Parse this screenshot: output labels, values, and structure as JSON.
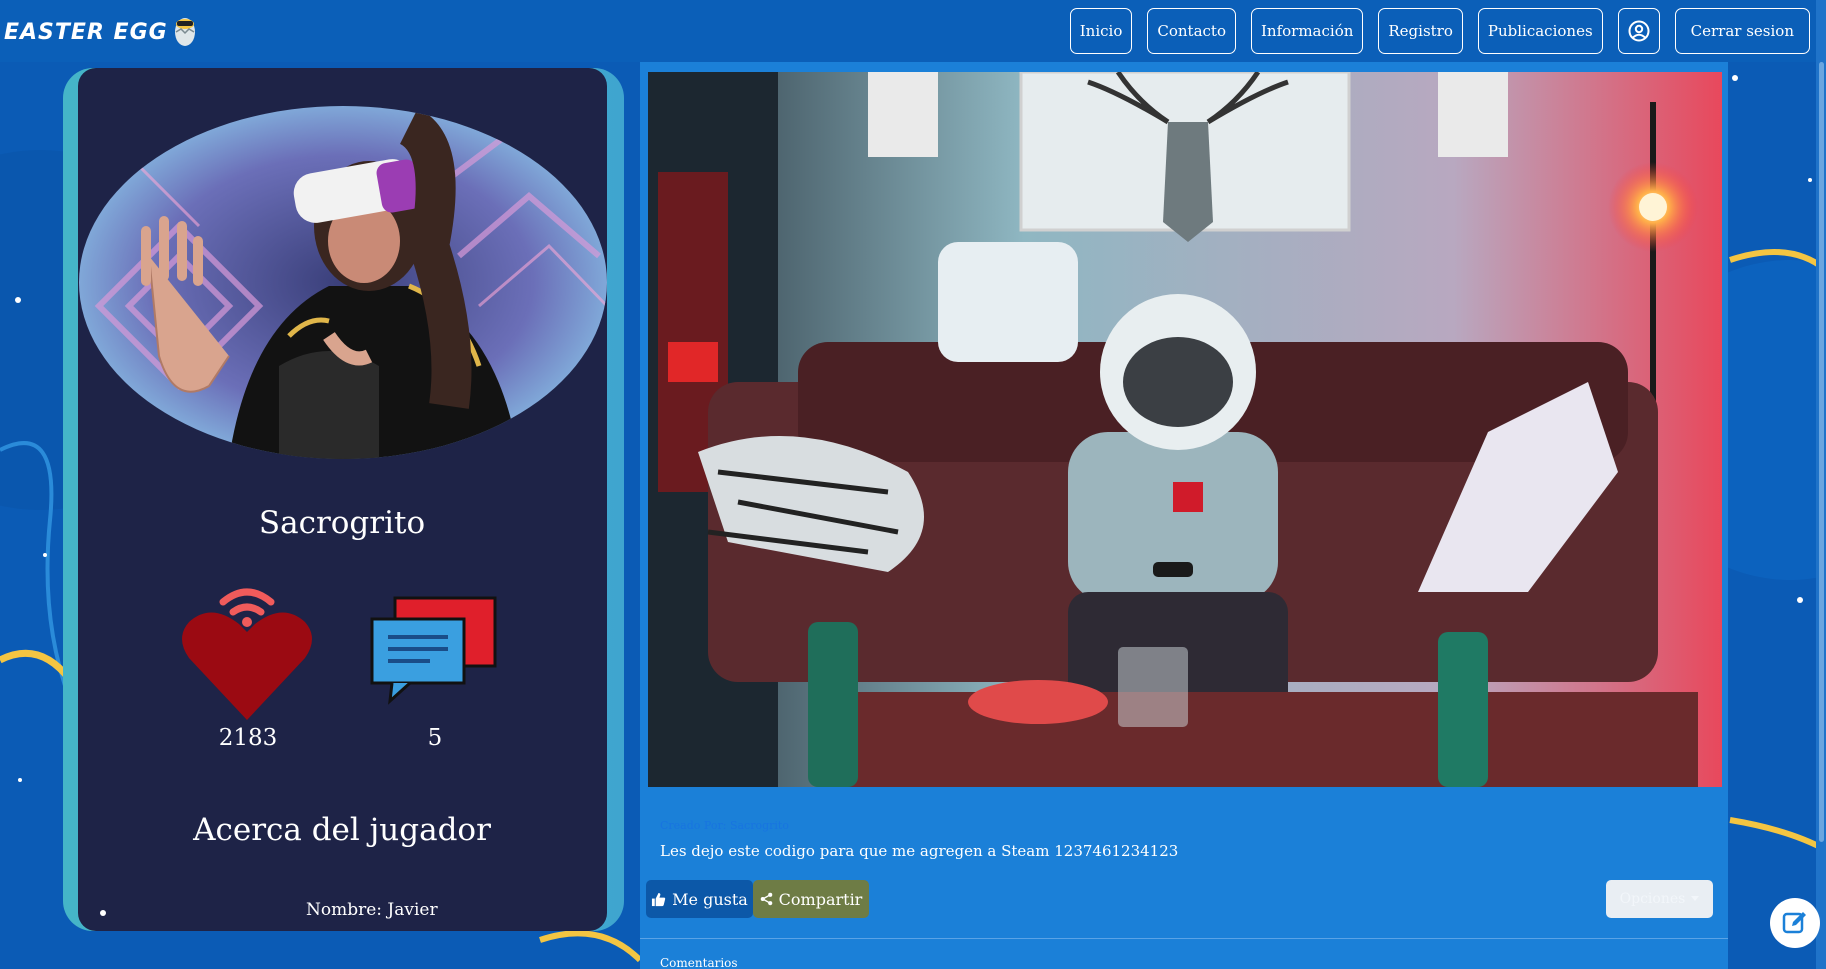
{
  "header": {
    "logo_text": "EASTER EGG",
    "nav": {
      "inicio": "Inicio",
      "contacto": "Contacto",
      "informacion": "Información",
      "registro": "Registro",
      "publicaciones": "Publicaciones",
      "cerrar_sesion": "Cerrar sesion"
    },
    "profile_icon": "user-circle-icon"
  },
  "profile": {
    "name": "Sacrogrito",
    "likes_count": "2183",
    "comments_count": "5",
    "about_title": "Acerca del jugador",
    "about_items": [
      "Nombre: Javier"
    ],
    "icons": {
      "likes": "heart-wifi-icon",
      "comments": "chat-bubbles-icon"
    }
  },
  "post": {
    "author": "Creado Por: Sacrogrito",
    "text": "Les dejo este codigo para que me agregen a Steam 1237461234123",
    "like_label": "Me gusta",
    "share_label": "Compartir",
    "options_label": "Opciones",
    "comments_label": "Comentarios",
    "icons": {
      "like": "thumbs-up-icon",
      "share": "share-icon",
      "options": "caret-down-icon"
    }
  },
  "fab_icon": "edit-icon",
  "colors": {
    "header_bg": "#0b5fb8",
    "card_bg": "#1e2347",
    "post_bg": "#1b80d8",
    "like_btn": "#0c58a8",
    "share_btn": "#6e7c45",
    "heart": "#9b0a12"
  }
}
